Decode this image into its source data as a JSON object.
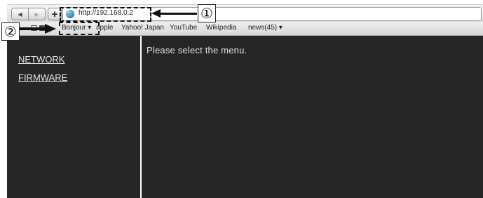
{
  "toolbar": {
    "back_icon": "back-arrow-icon",
    "forward_icon": "forward-arrow-icon",
    "add_label": "+",
    "address": "http://192.168.0.2"
  },
  "bookmarks": {
    "items": [
      {
        "label": "Bonjour ▾"
      },
      {
        "label": "apple"
      },
      {
        "label": "Yahoo! Japan"
      },
      {
        "label": "YouTube"
      },
      {
        "label": "Wikipedia"
      },
      {
        "label": "news(45) ▾"
      }
    ]
  },
  "sidebar": {
    "links": [
      {
        "label": "NETWORK"
      },
      {
        "label": "FIRMWARE"
      }
    ]
  },
  "main": {
    "message": "Please select the menu."
  },
  "callouts": {
    "one": "①",
    "two": "②"
  },
  "colors": {
    "panel_bg": "#262626",
    "text": "#e6e6e6"
  }
}
